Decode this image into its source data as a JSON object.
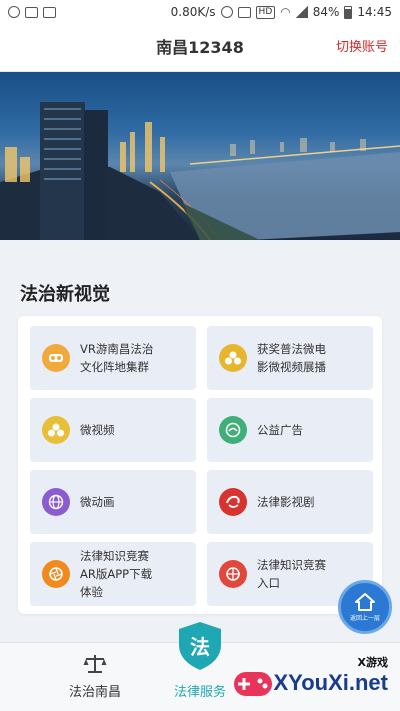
{
  "status_bar": {
    "speed": "0.80K/s",
    "hd": "HD",
    "battery": "84%",
    "time": "14:45"
  },
  "header": {
    "title": "南昌12348",
    "switch_account": "切换账号"
  },
  "section": {
    "title": "法治新视觉"
  },
  "tiles": [
    {
      "label": "VR游南昌法治\n文化阵地集群",
      "icon": "vr-glasses-icon",
      "color": "#f2a93b"
    },
    {
      "label": "获奖普法微电\n影微视频展播",
      "icon": "award-medals-icon",
      "color": "#e6b72e"
    },
    {
      "label": "微视频",
      "icon": "video-reels-icon",
      "color": "#e8bf36"
    },
    {
      "label": "公益广告",
      "icon": "public-ad-icon",
      "color": "#3fae78"
    },
    {
      "label": "微动画",
      "icon": "globe-icon",
      "color": "#8b5ccf"
    },
    {
      "label": "法律影视剧",
      "icon": "film-swirl-icon",
      "color": "#d8332f"
    },
    {
      "label": "法律知识竞赛\nAR版APP下载\n体验",
      "icon": "camera-aperture-icon",
      "color": "#f08a1e"
    },
    {
      "label": "法律知识竞赛\n入口",
      "icon": "ball-icon",
      "color": "#e2473c"
    }
  ],
  "bottom_nav": {
    "items": [
      {
        "label": "法治南昌",
        "icon": "scales-icon"
      },
      {
        "label": "法律服务",
        "icon": "shield-law-icon",
        "badge": "法"
      }
    ]
  },
  "back_button": {
    "label": "返回上一层"
  },
  "watermark": {
    "small": "X游戏",
    "big": "XYouXi.net"
  },
  "colors": {
    "accent": "#1fa8b3",
    "switch_account": "#d12a2a",
    "back_button": "#2c79d3"
  }
}
